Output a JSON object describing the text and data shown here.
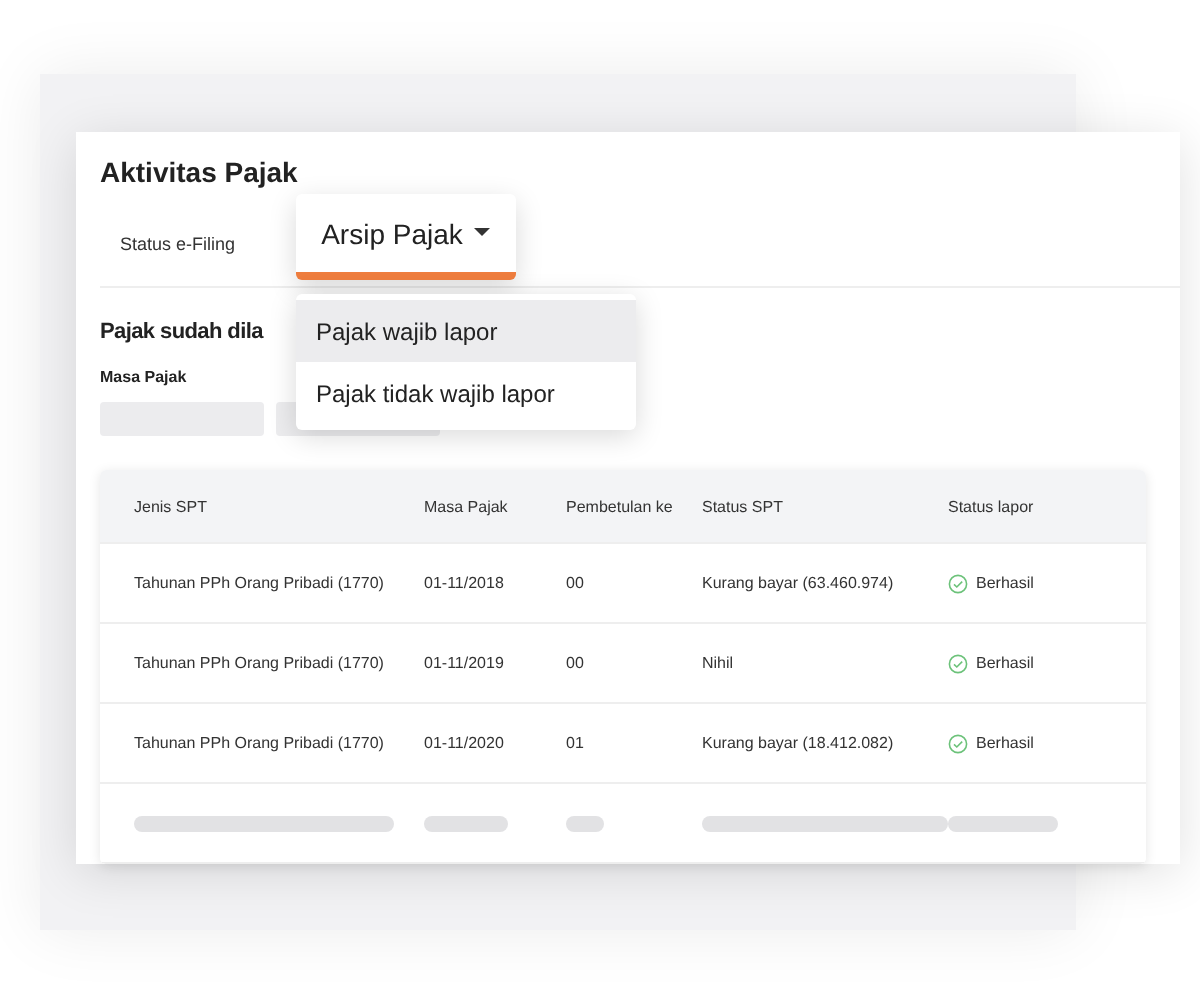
{
  "title": "Aktivitas Pajak",
  "tabs": [
    {
      "label": "Status e-Filing",
      "selected": false
    },
    {
      "label": "Arsip Pajak",
      "selected": true
    }
  ],
  "menu": [
    {
      "label": "Pajak wajib lapor",
      "selected": true
    },
    {
      "label": "Pajak tidak wajib lapor",
      "selected": false
    }
  ],
  "section_title": "Pajak sudah dila",
  "filter_label": "Masa Pajak",
  "table": {
    "columns": [
      "Jenis SPT",
      "Masa Pajak",
      "Pembetulan ke",
      "Status SPT",
      "Status lapor"
    ],
    "rows": [
      {
        "cells": [
          "Tahunan PPh Orang Pribadi (1770)",
          "01-11/2018",
          "00",
          "Kurang bayar (63.460.974)"
        ],
        "status": "Berhasil"
      },
      {
        "cells": [
          "Tahunan PPh Orang Pribadi (1770)",
          "01-11/2019",
          "00",
          "Nihil"
        ],
        "status": "Berhasil"
      },
      {
        "cells": [
          "Tahunan PPh Orang Pribadi (1770)",
          "01-11/2020",
          "01",
          "Kurang bayar (18.412.082)"
        ],
        "status": "Berhasil"
      }
    ]
  }
}
